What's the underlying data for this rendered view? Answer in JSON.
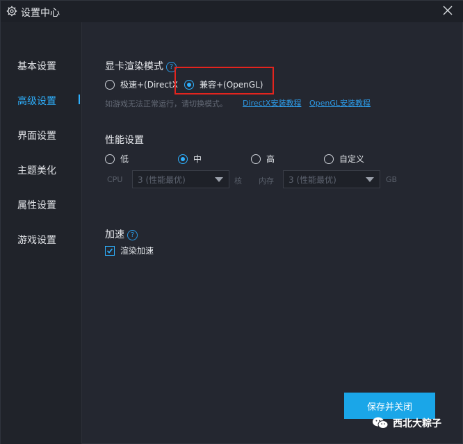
{
  "window": {
    "title": "设置中心"
  },
  "sidebar": {
    "items": [
      {
        "label": "基本设置"
      },
      {
        "label": "高级设置",
        "active": true
      },
      {
        "label": "界面设置"
      },
      {
        "label": "主题美化"
      },
      {
        "label": "属性设置"
      },
      {
        "label": "游戏设置"
      }
    ]
  },
  "render_mode": {
    "title": "显卡渲染模式",
    "help": "?",
    "options": [
      {
        "label": "极速+(DirectX",
        "checked": false
      },
      {
        "label": "兼容+(OpenGL)",
        "checked": true
      }
    ],
    "hint": "如游戏无法正常运行，请切换模式。",
    "links": [
      "DirectX安装教程",
      "OpenGL安装教程"
    ]
  },
  "performance": {
    "title": "性能设置",
    "options": [
      {
        "label": "低",
        "checked": false
      },
      {
        "label": "中",
        "checked": true
      },
      {
        "label": "高",
        "checked": false
      },
      {
        "label": "自定义",
        "checked": false
      }
    ],
    "cpu_label": "CPU",
    "cpu_value": "3 (性能最优)",
    "cpu_unit": "核",
    "memory_label": "内存",
    "memory_value": "3 (性能最优)",
    "memory_unit": "GB"
  },
  "acceleration": {
    "title": "加速",
    "help": "?",
    "checkbox_label": "渲染加速",
    "checked": true
  },
  "footer": {
    "save_label": "保存并关闭"
  },
  "watermark": {
    "text": "西北大粽子"
  },
  "colors": {
    "accent": "#2eb1ff",
    "button": "#1aa6e8",
    "highlight": "#e3241e",
    "background": "#242730"
  }
}
